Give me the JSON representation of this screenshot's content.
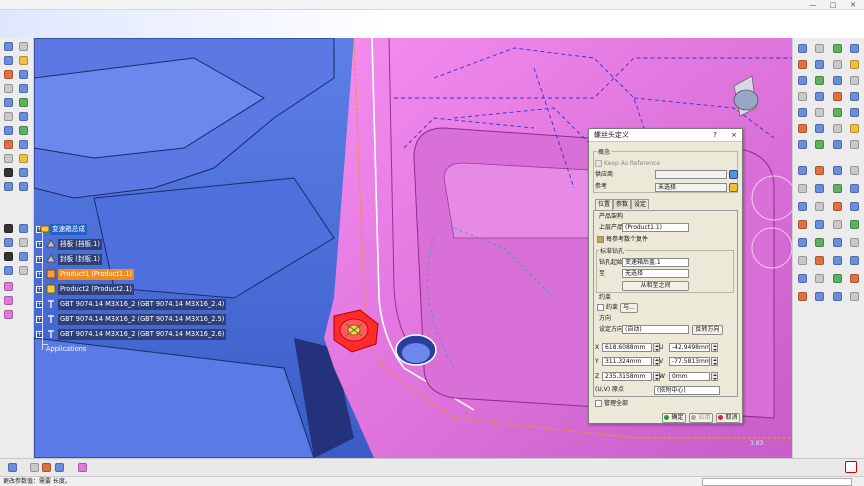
{
  "window": {
    "close_glyph": "✕",
    "maximize_glyph": "□",
    "minimize_glyph": "—"
  },
  "tree": {
    "items": [
      {
        "label": "变速箱总成",
        "icon": "assembly-icon",
        "state": "root"
      },
      {
        "label": "挡板 (挡板.1)",
        "icon": "part-icon",
        "state": "normal"
      },
      {
        "label": "封板 (封板.1)",
        "icon": "part-icon",
        "state": "normal"
      },
      {
        "label": "Product1 (Product1.1)",
        "icon": "product-icon",
        "state": "selected"
      },
      {
        "label": "Product2 (Product2.1)",
        "icon": "product-icon",
        "state": "normal"
      },
      {
        "label": "GBT 9074.14 M3X16_2 (GBT 9074.14 M3X16_2.4)",
        "icon": "bolt-icon",
        "state": "normal"
      },
      {
        "label": "GBT 9074.14 M3X16_2 (GBT 9074.14 M3X16_2.5)",
        "icon": "bolt-icon",
        "state": "normal"
      },
      {
        "label": "GBT 9074.14 M3X16_2 (GBT 9074.14 M3X16_2.6)",
        "icon": "bolt-icon",
        "state": "normal"
      },
      {
        "label": "Applications",
        "icon": "applications-icon",
        "state": "plain"
      }
    ],
    "toggle_glyph": "+"
  },
  "dialog": {
    "title": "螺丝头定义",
    "help": "?",
    "close": "×",
    "general": {
      "title": "概念",
      "keep_as_reference": "Keep As Reference",
      "supplier_label": "供应商",
      "supplier_value": "",
      "reference_label": "参考",
      "reference_value": "未选择"
    },
    "tabs": [
      "位置",
      "参数",
      "设定"
    ],
    "product": {
      "title": "产品架构",
      "upper_label": "上层产品",
      "upper_value": "(Product1.1)",
      "each_ref_label": "每参考数个复件"
    },
    "standard_hole": {
      "title": "标准钻孔",
      "drill_start_label": "钻孔起始",
      "drill_start_value": "变速箱后盖.1",
      "to_label": "至",
      "to_value": "无选择",
      "from_to_button": "从和至之间"
    },
    "constraint": {
      "title": "约束",
      "label": "约束",
      "button": "与..."
    },
    "direction": {
      "title": "方向",
      "label": "设定方向",
      "value": "(自动)",
      "reverse_button": "反转方向"
    },
    "coords": {
      "x_label": "X",
      "x_value": "618.6088mm",
      "y_label": "Y",
      "y_value": "311.324mm",
      "z_label": "Z",
      "z_value": "235.3158mm",
      "u_label": "U",
      "u_value": "-42.9498mm",
      "v_label": "V",
      "v_value": "-77.5813mm",
      "w_label": "W",
      "w_value": "0mm",
      "origin_label": "(U,V) 原点",
      "origin_value": "(依附中心)"
    },
    "manage_all": "管理全部",
    "ok": "确定",
    "apply": "应用",
    "cancel": "取消"
  },
  "viewport": {
    "scale_text": "3.83"
  },
  "status": {
    "text": "更改参数值：需要 长度。"
  },
  "colors": {
    "viewport_blue": "#4a6fd8",
    "part_pink": "#e77de0",
    "selection_orange": "#f28c1e",
    "bolt_red": "#ff2020"
  }
}
